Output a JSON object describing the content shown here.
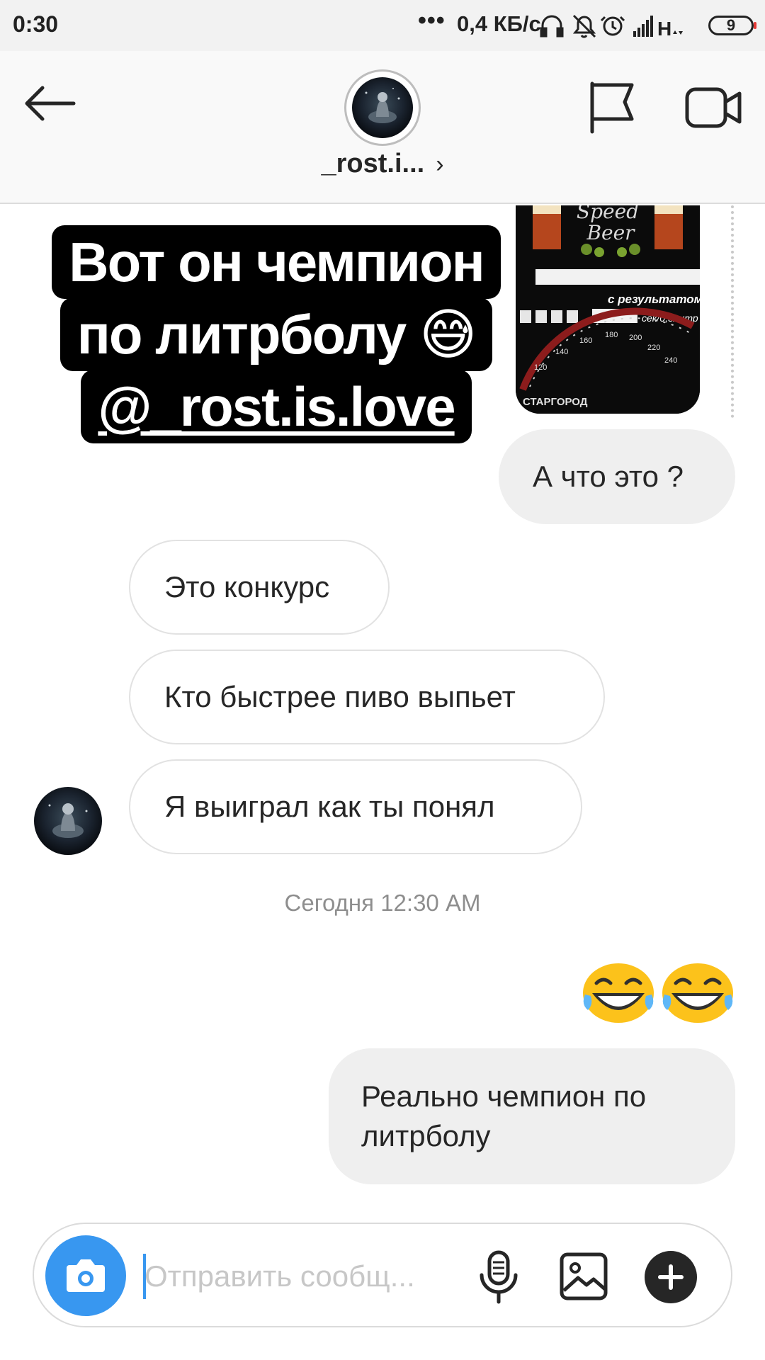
{
  "status_bar": {
    "time": "0:30",
    "dots": "•••",
    "network_speed": "0,4 КБ/с",
    "network_type": "H",
    "battery_level": "9"
  },
  "header": {
    "username": "_rost.i...",
    "chevron": "›",
    "icons": [
      "back-arrow-icon",
      "avatar",
      "flag-icon",
      "video-call-icon"
    ]
  },
  "story_reply": {
    "caption_lines": [
      "Вот он чемпион",
      "по литрболу 😅",
      "@_rost.is.love"
    ],
    "thumbnail_text": {
      "title_line1": "Speed",
      "title_line2": "Beer",
      "result_label": "с результатом",
      "unit_label": "сек/0,5литр",
      "brand": "СТАРГОРОД"
    }
  },
  "messages": [
    {
      "direction": "outgoing",
      "text": "А что это ?"
    },
    {
      "direction": "incoming",
      "text": "Это конкурс"
    },
    {
      "direction": "incoming",
      "text": "Кто быстрее пиво выпьет"
    },
    {
      "direction": "incoming",
      "text": "Я выиграл как ты понял"
    },
    {
      "direction": "outgoing",
      "text": "😁😁",
      "type": "emoji"
    },
    {
      "direction": "outgoing",
      "text": "Реально чемпион по литрболу"
    }
  ],
  "timestamp": "Сегодня 12:30 AM",
  "composer": {
    "placeholder": "Отправить сообщ...",
    "buttons": [
      "camera-icon",
      "microphone-icon",
      "gallery-icon",
      "plus-icon"
    ]
  },
  "colors": {
    "accent": "#3897f0",
    "outgoing_bubble": "#efefef",
    "incoming_border": "#e2e2e2",
    "timestamp": "#8e8e8e"
  }
}
